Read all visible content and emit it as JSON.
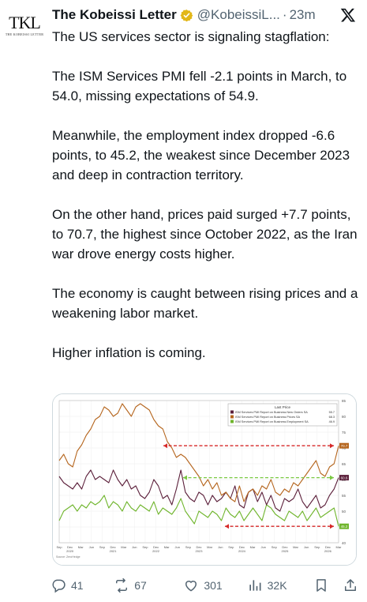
{
  "author": {
    "display_name": "The Kobeissi Letter",
    "handle": "@KobeissiL...",
    "separator": "·",
    "time": "23m",
    "avatar_text": "TKL",
    "avatar_subtext": "THE KOBEISSI LETTER"
  },
  "tweet": {
    "paragraphs": [
      "The US services sector is signaling stagflation:",
      "The ISM Services PMI fell -2.1 points in March, to 54.0, missing expectations of 54.9.",
      "Meanwhile, the employment index dropped -6.6 points, to 45.2, the weakest since December 2023 and deep in contraction territory.",
      "On the other hand, prices paid surged +7.7 points, to 70.7, the highest since October 2022, as the Iran war drove energy costs higher.",
      "The economy is caught between rising prices and a weakening labor market.",
      "Higher inflation is coming."
    ]
  },
  "actions": {
    "replies": "41",
    "reposts": "67",
    "likes": "301",
    "views": "32K"
  },
  "colors": {
    "new_orders": "#5b1f3a",
    "prices": "#b5651d",
    "employment": "#6fb52c",
    "arrow_red": "#d62828",
    "arrow_green": "#7ac943"
  },
  "chart_data": {
    "type": "line",
    "legend_title": "Last Price",
    "legend_placement": "top-right",
    "series": [
      {
        "name": "ISM Services PMI Report on Business New Orders SA",
        "last": "55.7"
      },
      {
        "name": "ISM Services PMI Report on Business Prices SA",
        "last": "68.3"
      },
      {
        "name": "ISM Services PMI Report on Business Employment SA",
        "last": "46.9"
      }
    ],
    "end_labels": [
      "70.7",
      "60.6",
      "45.2"
    ],
    "y_ticks": [
      "85",
      "80",
      "75",
      "70",
      "65",
      "60",
      "55",
      "50",
      "45",
      "40"
    ],
    "ylim": [
      40,
      85
    ],
    "x_month_ticks": [
      "Sep",
      "Dec",
      "Mar",
      "Jun",
      "Sep",
      "Dec",
      "Mar",
      "Jun",
      "Sep",
      "Dec",
      "Mar",
      "Jun",
      "Sep",
      "Dec",
      "Mar",
      "Jun",
      "Sep",
      "Dec",
      "Mar",
      "Jun",
      "Sep",
      "Dec",
      "Mar",
      "Jun",
      "Sep",
      "Dec",
      "Mar"
    ],
    "x_year_ticks": [
      "2020",
      "2021",
      "2022",
      "2023",
      "2024",
      "2025",
      "2026"
    ],
    "source": "Source: ZeroHedge",
    "prices": [
      66,
      68,
      65,
      64,
      69,
      71,
      74,
      76,
      79,
      80,
      83,
      82,
      80,
      81,
      84,
      82,
      80,
      83,
      84,
      83,
      82,
      79,
      77,
      76,
      72,
      70,
      67,
      68,
      67,
      65,
      63,
      61,
      58,
      60,
      57,
      59,
      55,
      56,
      54,
      53,
      58,
      53,
      56,
      57,
      55,
      58,
      57,
      60,
      56,
      55,
      57,
      56,
      59,
      58,
      60,
      62,
      64,
      66,
      62,
      61,
      64,
      65,
      70.7
    ],
    "new_orders": [
      61,
      59,
      58,
      57,
      59,
      57,
      61,
      63,
      60,
      61,
      60,
      59,
      63,
      60,
      58,
      60,
      57,
      58,
      55,
      54,
      56,
      60,
      58,
      54,
      55,
      52,
      57,
      63,
      56,
      54,
      53,
      56,
      55,
      52,
      55,
      53,
      54,
      56,
      54,
      58,
      52,
      51,
      56,
      57,
      53,
      56,
      52,
      55,
      51,
      50,
      54,
      53,
      54,
      57,
      53,
      51,
      53,
      55,
      51,
      52,
      55,
      57,
      60.6
    ],
    "employment": [
      47,
      50,
      51,
      52,
      50,
      52,
      51,
      53,
      52,
      53,
      55,
      51,
      53,
      52,
      50,
      53,
      51,
      50,
      52,
      51,
      50,
      53,
      49,
      51,
      50,
      49,
      51,
      54,
      50,
      48,
      46,
      50,
      49,
      48,
      50,
      49,
      47,
      51,
      49,
      48,
      50,
      47,
      49,
      51,
      49,
      47,
      52,
      51,
      49,
      48,
      47,
      50,
      49,
      48,
      50,
      47,
      49,
      51,
      48,
      49,
      50,
      51,
      45.2
    ]
  }
}
